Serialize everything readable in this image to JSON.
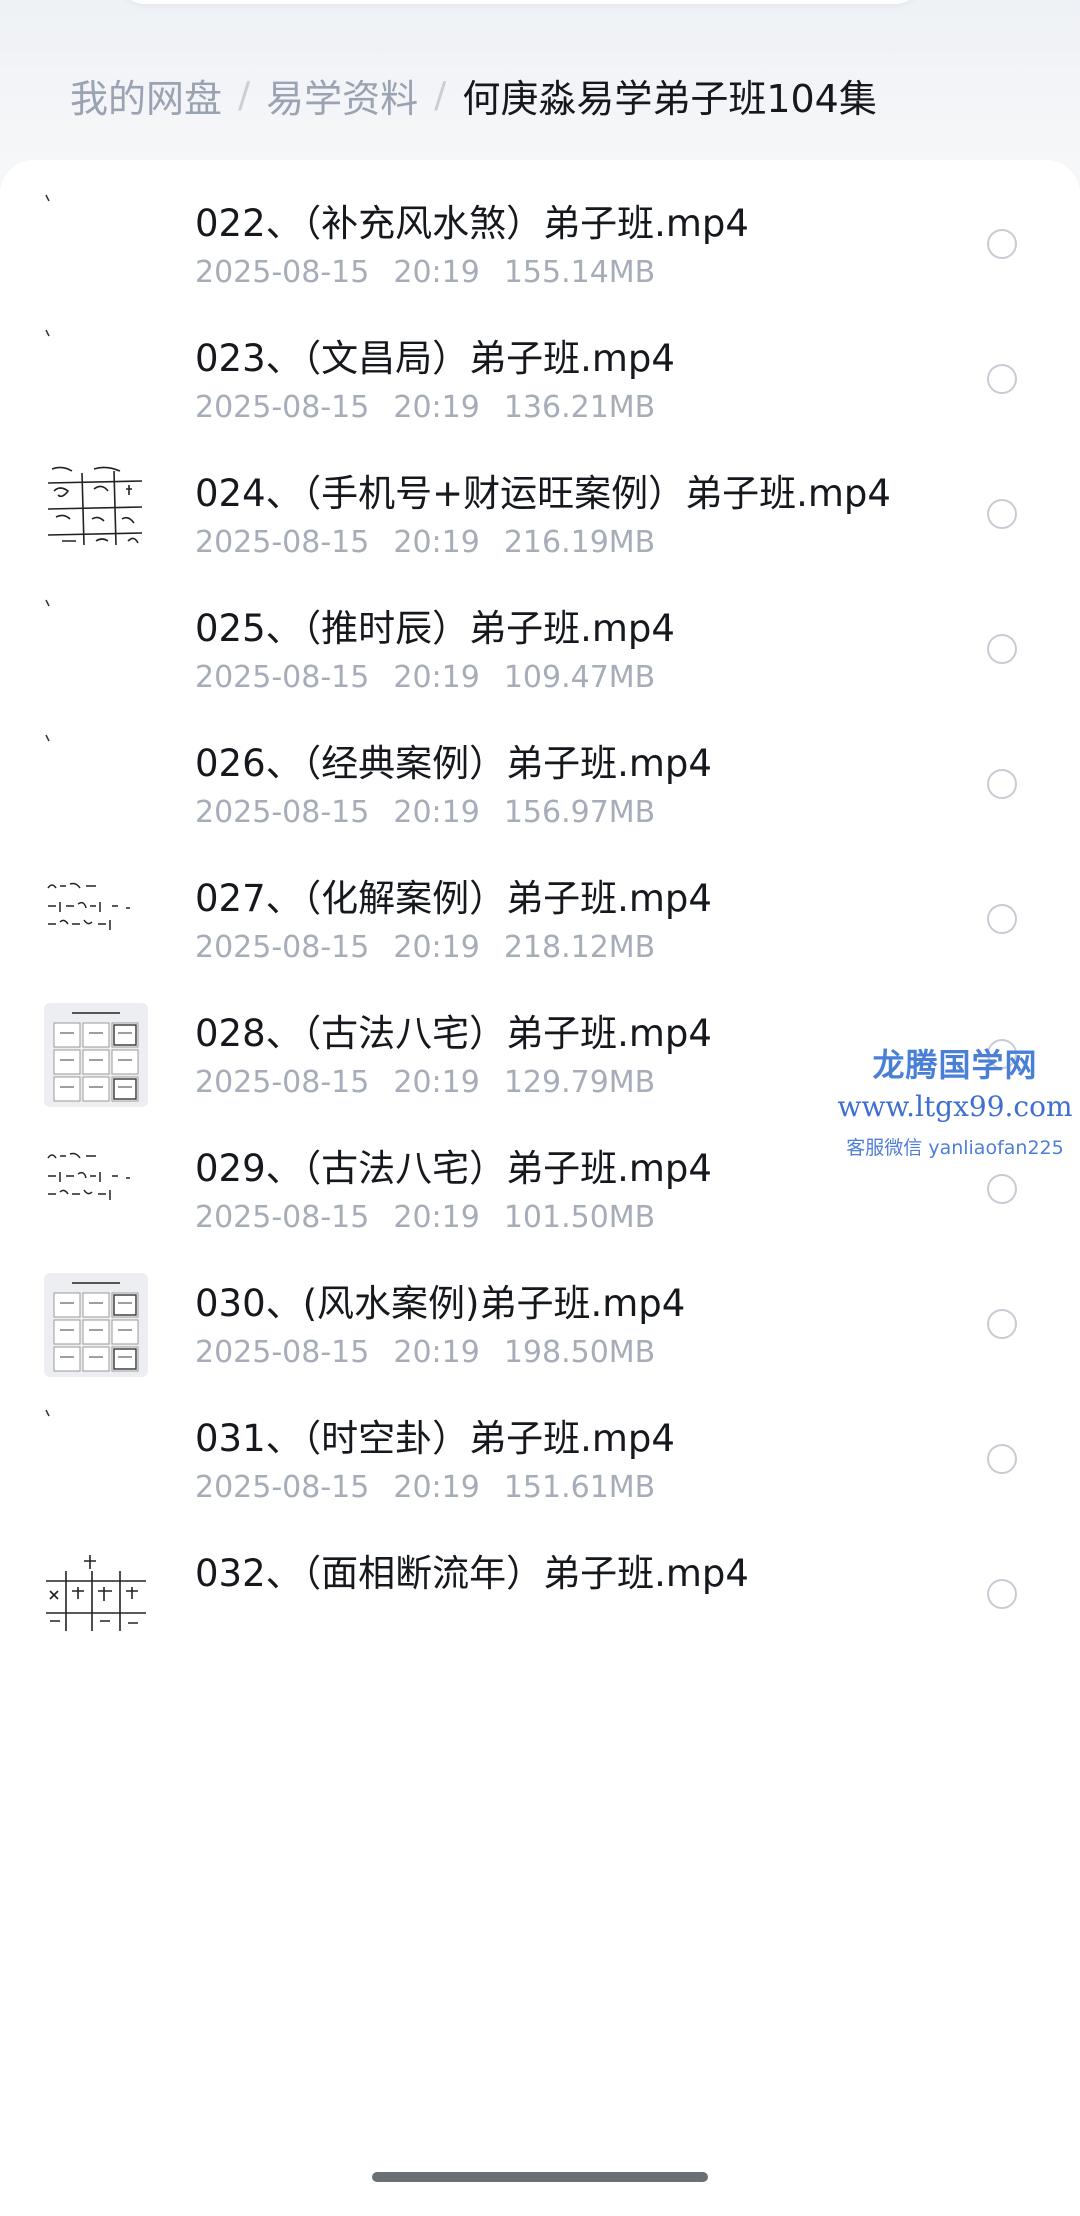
{
  "breadcrumb": {
    "root": "我的网盘",
    "folder": "易学资料",
    "current": "何庚淼易学弟子班104集",
    "separator": "/"
  },
  "files": [
    {
      "name": "022、（补充风水煞）弟子班.mp4",
      "date": "2025-08-15",
      "time": "20:19",
      "size": "155.14MB",
      "thumb": "blank"
    },
    {
      "name": "023、（文昌局）弟子班.mp4",
      "date": "2025-08-15",
      "time": "20:19",
      "size": "136.21MB",
      "thumb": "blank"
    },
    {
      "name": "024、（手机号+财运旺案例）弟子班.mp4",
      "date": "2025-08-15",
      "time": "20:19",
      "size": "216.19MB",
      "thumb": "handwritten-grid"
    },
    {
      "name": "025、（推时辰）弟子班.mp4",
      "date": "2025-08-15",
      "time": "20:19",
      "size": "109.47MB",
      "thumb": "blank"
    },
    {
      "name": "026、（经典案例）弟子班.mp4",
      "date": "2025-08-15",
      "time": "20:19",
      "size": "156.97MB",
      "thumb": "blank"
    },
    {
      "name": "027、（化解案例）弟子班.mp4",
      "date": "2025-08-15",
      "time": "20:19",
      "size": "218.12MB",
      "thumb": "handwritten-numbers"
    },
    {
      "name": "028、（古法八宅）弟子班.mp4",
      "date": "2025-08-15",
      "time": "20:19",
      "size": "129.79MB",
      "thumb": "bazhai-chart"
    },
    {
      "name": "029、（古法八宅）弟子班.mp4",
      "date": "2025-08-15",
      "time": "20:19",
      "size": "101.50MB",
      "thumb": "handwritten-numbers"
    },
    {
      "name": "030、(风水案例)弟子班.mp4",
      "date": "2025-08-15",
      "time": "20:19",
      "size": "198.50MB",
      "thumb": "bazhai-chart"
    },
    {
      "name": "031、（时空卦）弟子班.mp4",
      "date": "2025-08-15",
      "time": "20:19",
      "size": "151.61MB",
      "thumb": "blank"
    },
    {
      "name": "032、（面相断流年）弟子班.mp4",
      "date": "",
      "time": "",
      "size": "",
      "thumb": "handwritten-table"
    }
  ],
  "watermark": {
    "title": "龙腾国学网",
    "url": "www.ltgx99.com",
    "contact": "客服微信 yanliaofan225"
  },
  "colors": {
    "text_primary": "#15181d",
    "text_secondary": "#a6adb9",
    "breadcrumb_muted": "#9aa3b2",
    "watermark_blue": "#4a7fd8",
    "radio_border": "#c7ccd3"
  }
}
